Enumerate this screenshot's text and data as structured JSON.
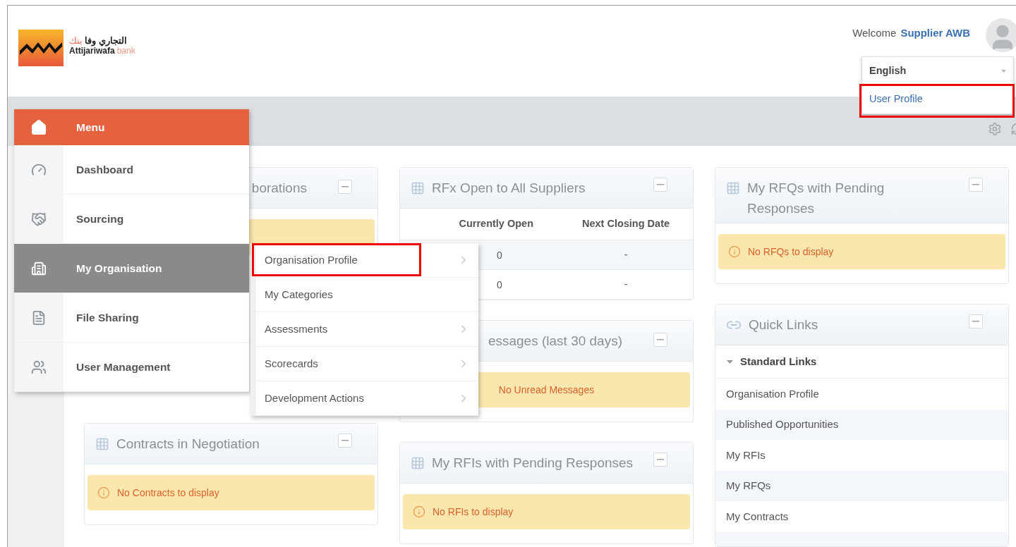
{
  "header": {
    "logo": {
      "arabic_name": "التجاري وفا",
      "arabic_bank": "بنك",
      "name": "Attijariwafa",
      "bank": "bank"
    },
    "welcome": "Welcome",
    "user_name": "Supplier AWB"
  },
  "user_menu": {
    "language": "English",
    "items": [
      {
        "label": "User Profile",
        "highlighted": true
      }
    ]
  },
  "menu": {
    "title": "Menu",
    "items": [
      {
        "label": "Dashboard",
        "selected": false
      },
      {
        "label": "Sourcing",
        "selected": false
      },
      {
        "label": "My Organisation",
        "selected": true
      },
      {
        "label": "File Sharing",
        "selected": false
      },
      {
        "label": "User Management",
        "selected": false
      }
    ]
  },
  "submenu": {
    "items": [
      {
        "label": "Organisation Profile",
        "has_children": true,
        "highlighted": true
      },
      {
        "label": "My Categories",
        "has_children": false,
        "highlighted": false
      },
      {
        "label": "Assessments",
        "has_children": true,
        "highlighted": false
      },
      {
        "label": "Scorecards",
        "has_children": true,
        "highlighted": false
      },
      {
        "label": "Development Actions",
        "has_children": true,
        "highlighted": false
      }
    ]
  },
  "columns": [
    {
      "cards": [
        {
          "kind": "alert",
          "title": "borations",
          "title_icon": false,
          "alert": {
            "info_icon": false
          }
        },
        {
          "kind": "alert",
          "title": "Contracts in Negotiation",
          "title_icon": true,
          "alert": {
            "info_icon": true,
            "message": "No Contracts to display"
          }
        }
      ]
    },
    {
      "cards": [
        {
          "kind": "table",
          "title": "RFx Open to All Suppliers",
          "title_icon": true,
          "table": {
            "columns": [
              "Currently Open",
              "Next Closing Date"
            ],
            "rows": [
              [
                "0",
                "-"
              ],
              [
                "0",
                "-"
              ]
            ]
          }
        },
        {
          "kind": "alert",
          "title": "essages (last 30 days)",
          "title_icon": false,
          "alert": {
            "info_icon": false,
            "message": "No Unread Messages"
          }
        },
        {
          "kind": "alert",
          "title": "My RFIs with Pending Responses",
          "title_icon": true,
          "alert": {
            "info_icon": true,
            "message": "No RFIs to display"
          }
        }
      ]
    },
    {
      "cards": [
        {
          "kind": "alert",
          "title": "My RFQs with Pending Responses",
          "title_icon": true,
          "alert": {
            "info_icon": true,
            "message": "No RFQs to display"
          }
        },
        {
          "kind": "links",
          "title": "Quick Links",
          "title_icon": true,
          "links": {
            "group": "Standard Links",
            "expanded": true,
            "items": [
              "Organisation Profile",
              "Published Opportunities",
              "My RFIs",
              "My RFQs",
              "My Contracts"
            ]
          }
        }
      ]
    }
  ]
}
